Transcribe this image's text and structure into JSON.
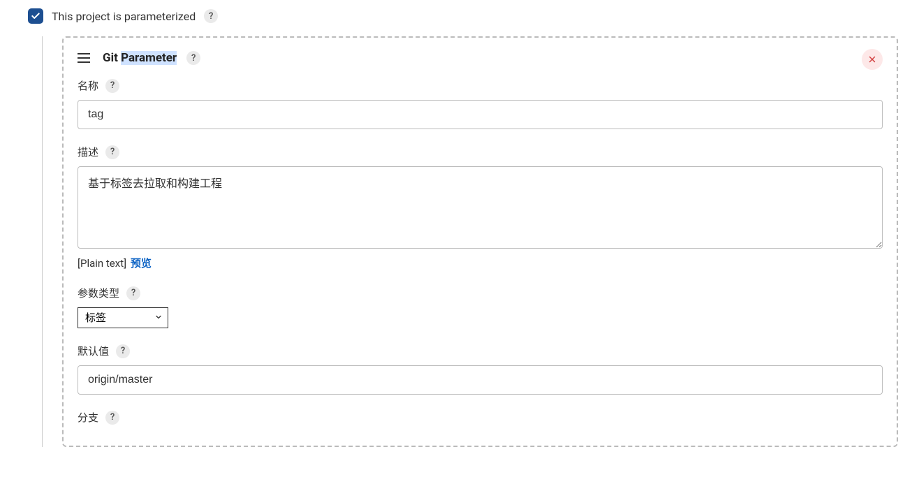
{
  "top": {
    "checked": true,
    "label": "This project is parameterized"
  },
  "parameter": {
    "title_prefix": "Git ",
    "title_highlight": "Parameter",
    "fields": {
      "name": {
        "label": "名称",
        "value": "tag"
      },
      "description": {
        "label": "描述",
        "value": "基于标签去拉取和构建工程",
        "format_hint": "[Plain text]",
        "preview_link": "预览"
      },
      "param_type": {
        "label": "参数类型",
        "selected": "标签"
      },
      "default_value": {
        "label": "默认值",
        "value": "origin/master"
      },
      "branch": {
        "label": "分支"
      }
    }
  }
}
